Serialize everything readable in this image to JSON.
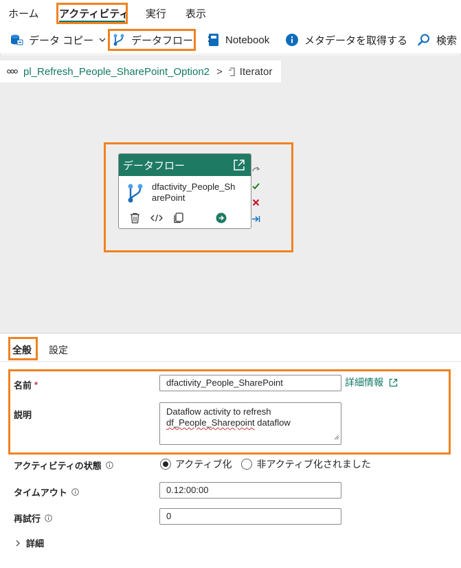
{
  "menu": {
    "tabs": [
      {
        "label": "ホーム"
      },
      {
        "label": "アクティビティ"
      },
      {
        "label": "実行"
      },
      {
        "label": "表示"
      }
    ]
  },
  "toolbar": {
    "copy_data": "データ コピー",
    "dataflow": "データフロー",
    "notebook": "Notebook",
    "get_metadata": "メタデータを取得する",
    "lookup": "検索"
  },
  "breadcrumb": {
    "pipeline": "pl_Refresh_People_SharePoint_Option2",
    "separator": ">",
    "current": "Iterator"
  },
  "activity": {
    "type": "データフロー",
    "name": "dfactivity_People_SharePoint"
  },
  "properties": {
    "tabs": [
      {
        "label": "全般"
      },
      {
        "label": "設定"
      }
    ],
    "name_label": "名前",
    "required_mark": "*",
    "name_value": "dfactivity_People_SharePoint",
    "more_info": "詳細情報",
    "description_label": "説明",
    "description_line1": "Dataflow activity to refresh",
    "description_line2_a": "df_People_Sharepoint",
    "description_line2_b": " dataflow",
    "state_label": "アクティビティの状態",
    "state_active": "アクティブ化",
    "state_inactive": "非アクティブ化されました",
    "state_selected": "アクティブ化",
    "timeout_label": "タイムアウト",
    "timeout_value": "0.12:00:00",
    "retry_label": "再試行",
    "retry_value": "0",
    "details_label": "詳細"
  },
  "colors": {
    "accent": "#117865",
    "activity_header": "#1f7a64",
    "highlight": "#f08220",
    "canvas": "#ededed"
  }
}
